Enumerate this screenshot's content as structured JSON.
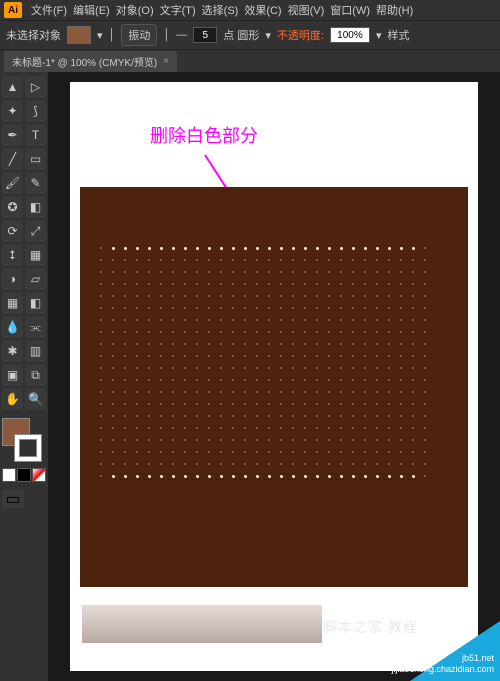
{
  "menubar": {
    "items": [
      "文件(F)",
      "编辑(E)",
      "对象(O)",
      "文字(T)",
      "选择(S)",
      "效果(C)",
      "视图(V)",
      "窗口(W)",
      "帮助(H)"
    ]
  },
  "optionbar": {
    "status": "未选择对象",
    "transform_btn": "振动",
    "stroke_value": "5",
    "stroke_label": "点 圆形",
    "opacity_label": "不透明度:",
    "opacity_value": "100%",
    "style_label": "样式"
  },
  "tab": {
    "title": "未标题-1* @ 100% (CMYK/预览)",
    "close": "×"
  },
  "tools": [
    [
      "selection-tool",
      "direct-selection-tool"
    ],
    [
      "magic-wand-tool",
      "lasso-tool"
    ],
    [
      "pen-tool",
      "type-tool"
    ],
    [
      "line-tool",
      "rectangle-tool"
    ],
    [
      "paintbrush-tool",
      "pencil-tool"
    ],
    [
      "blob-brush-tool",
      "eraser-tool"
    ],
    [
      "rotate-tool",
      "scale-tool"
    ],
    [
      "width-tool",
      "free-transform-tool"
    ],
    [
      "shape-builder-tool",
      "perspective-tool"
    ],
    [
      "mesh-tool",
      "gradient-tool"
    ],
    [
      "eyedropper-tool",
      "blend-tool"
    ],
    [
      "symbol-sprayer-tool",
      "column-graph-tool"
    ],
    [
      "artboard-tool",
      "slice-tool"
    ],
    [
      "hand-tool",
      "zoom-tool"
    ]
  ],
  "annotation": {
    "text": "删除白色部分"
  },
  "colors": {
    "accent": "#ff9a00",
    "fill": "#8b5a3c",
    "canvas_bg": "#4d220e",
    "annotation": "#ff00ff",
    "corner": "#1aa8dd"
  },
  "watermark": {
    "center": "脚本之家 教程",
    "corner_line1": "jb51.net",
    "corner_line2": "jijiaocheng.chazidian.com"
  }
}
